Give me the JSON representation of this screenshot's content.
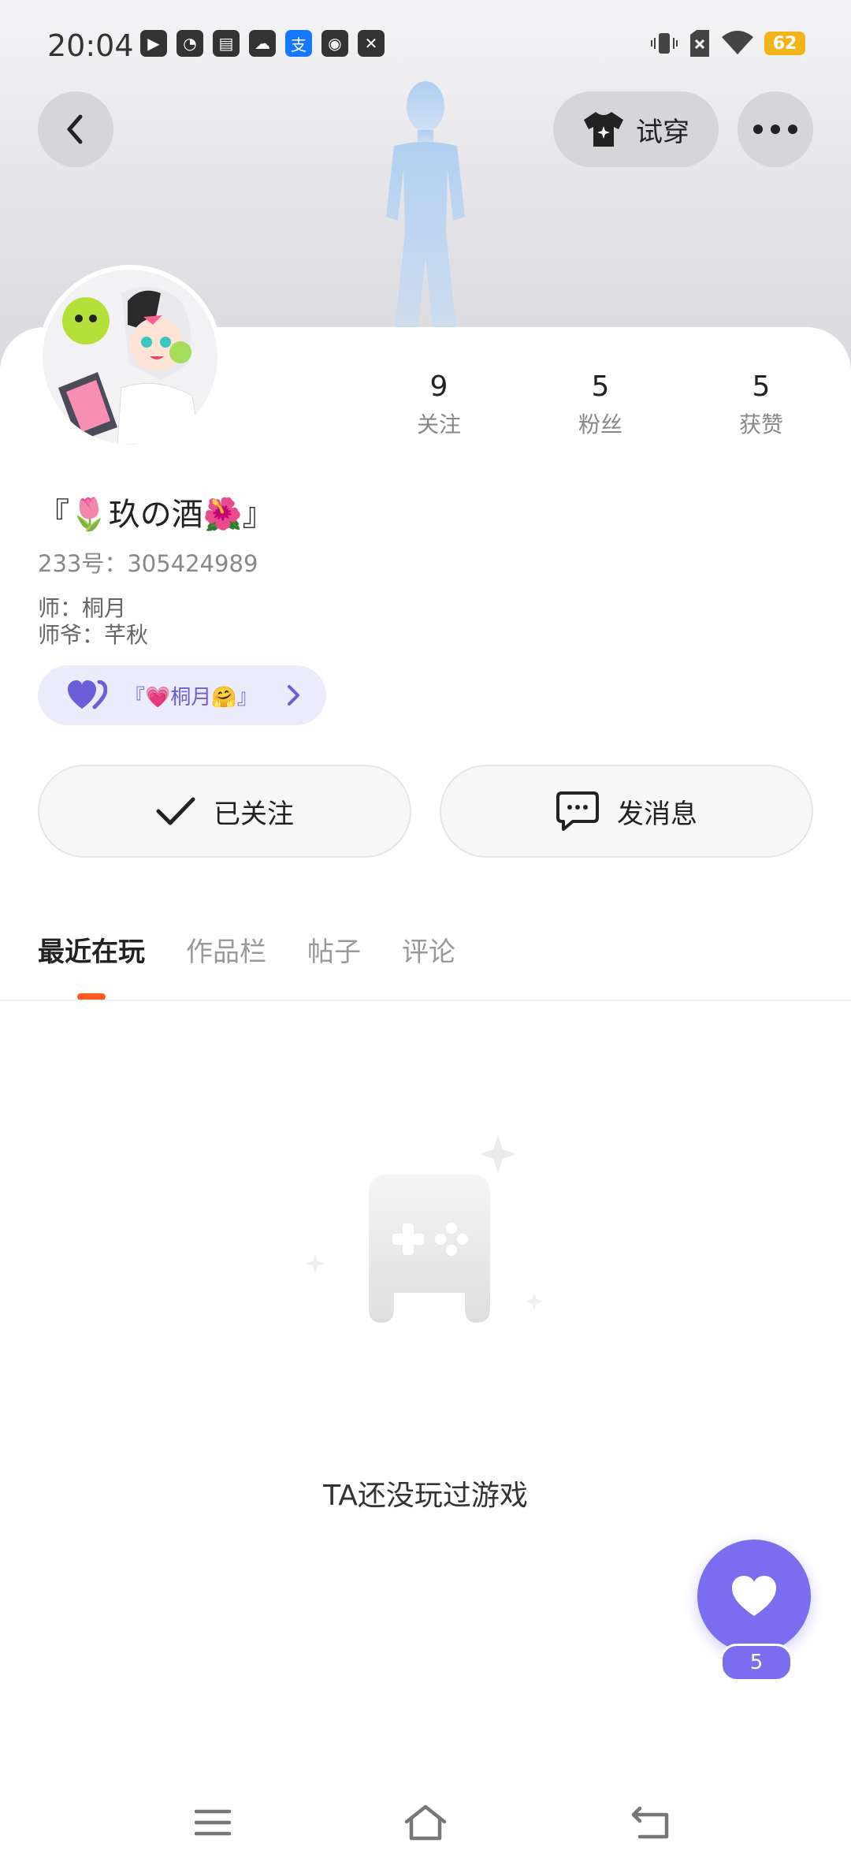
{
  "status_bar": {
    "time": "20:04",
    "battery": "62",
    "app_icons": [
      "play-icon",
      "speed-icon",
      "book-icon",
      "cloud-icon",
      "alipay-icon",
      "cat-icon",
      "capcut-icon"
    ],
    "alipay_glyph": "支"
  },
  "header": {
    "try_on_label": "试穿"
  },
  "stats": {
    "following_count": "9",
    "following_label": "关注",
    "fans_count": "5",
    "fans_label": "粉丝",
    "likes_count": "5",
    "likes_label": "获赞"
  },
  "profile": {
    "nickname": "『🌷玖の酒🌺』",
    "uid": "233号：305424989",
    "master": "师：桐月",
    "grandmaster": "师爷：芊秋",
    "bond_name": "『💗桐月🤗』"
  },
  "actions": {
    "followed_label": "已关注",
    "message_label": "发消息"
  },
  "tabs": [
    {
      "label": "最近在玩",
      "active": true
    },
    {
      "label": "作品栏",
      "active": false
    },
    {
      "label": "帖子",
      "active": false
    },
    {
      "label": "评论",
      "active": false
    }
  ],
  "empty_state": {
    "message": "TA还没玩过游戏"
  },
  "like_fab": {
    "count": "5"
  },
  "colors": {
    "accent_purple": "#7b6df0",
    "tab_indicator": "#ff5a1f",
    "battery": "#f2b418"
  }
}
